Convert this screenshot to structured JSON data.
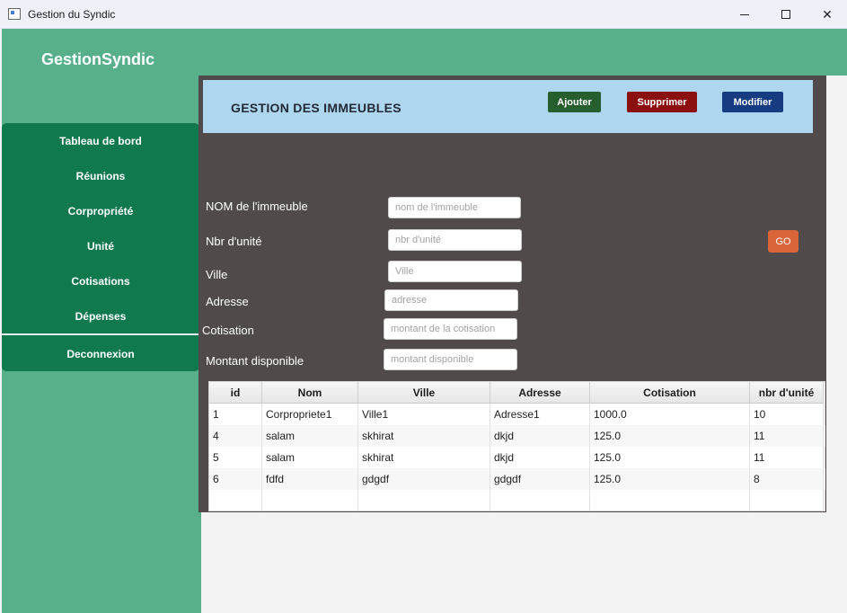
{
  "window": {
    "title": "Gestion du Syndic",
    "minimize": "",
    "maximize": "",
    "close": "✕"
  },
  "brand": "GestionSyndic",
  "sidebar": {
    "items": [
      {
        "label": "Tableau de bord"
      },
      {
        "label": "Réunions"
      },
      {
        "label": "Corpropriété"
      },
      {
        "label": "Unité"
      },
      {
        "label": "Cotisations"
      },
      {
        "label": "Dépenses"
      }
    ],
    "logout": "Deconnexion"
  },
  "banner": {
    "title": "GESTION DES IMMEUBLES",
    "ajouter": "Ajouter",
    "supprimer": "Supprimer",
    "modifier": "Modifier"
  },
  "form": {
    "nom": {
      "label": "NOM de l'immeuble",
      "placeholder": "nom de l'immeuble",
      "value": ""
    },
    "nbr": {
      "label": "Nbr d'unité",
      "placeholder": "nbr d'unité",
      "value": ""
    },
    "ville": {
      "label": "Ville",
      "placeholder": "Ville",
      "value": ""
    },
    "adresse": {
      "label": "Adresse",
      "placeholder": "adresse",
      "value": ""
    },
    "cotisation": {
      "label": "Cotisation",
      "placeholder": "montant de la cotisation",
      "value": ""
    },
    "montant": {
      "label": "Montant disponible",
      "placeholder": "montant disponible",
      "value": ""
    },
    "go": "GO"
  },
  "table": {
    "columns": [
      "id",
      "Nom",
      "Ville",
      "Adresse",
      "Cotisation",
      "nbr d'unité"
    ],
    "rows": [
      [
        "1",
        "Corpropriete1",
        "Ville1",
        "Adresse1",
        "1000.0",
        "10"
      ],
      [
        "4",
        "salam",
        "skhirat",
        "dkjd",
        "125.0",
        "11"
      ],
      [
        "5",
        "salam",
        "skhirat",
        "dkjd",
        "125.0",
        "11"
      ],
      [
        "6",
        "fdfd",
        "gdgdf",
        "gdgdf",
        "125.0",
        "8"
      ],
      [
        "",
        "",
        "",
        "",
        "",
        ""
      ]
    ]
  },
  "colors": {
    "accent_green": "#58b08a",
    "nav_green": "#11794e",
    "panel_dark": "#504a4a",
    "banner_blue": "#afd6ef",
    "ajouter_bg": "#275e2e",
    "supprimer_bg": "#8c0f0f",
    "modifier_bg": "#173b80",
    "go_bg": "#d9643a"
  }
}
